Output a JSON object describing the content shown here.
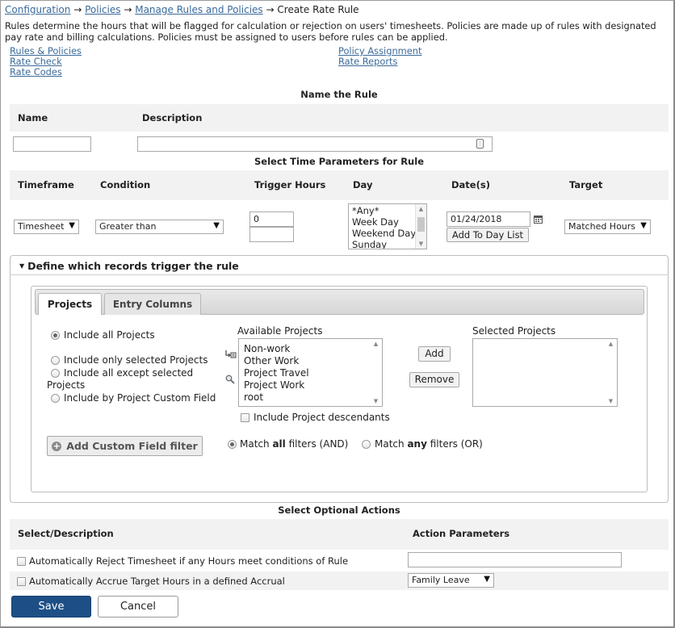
{
  "breadcrumb": {
    "items": [
      "Configuration",
      "Policies",
      "Manage Rules and Policies"
    ],
    "separator": "→",
    "current": "Create Rate Rule"
  },
  "intro": "Rules determine the hours that will be flagged for calculation or rejection on users' timesheets. Policies are made up of rules with designated pay rate and billing calculations. Policies must be assigned to users before rules can be applied.",
  "quick_links": {
    "left": [
      "Rules & Policies",
      "Rate Check",
      "Rate Codes"
    ],
    "right": [
      "Policy Assignment",
      "Rate Reports"
    ]
  },
  "name_section": {
    "title": "Name the Rule",
    "name_label": "Name",
    "description_label": "Description",
    "name_value": "",
    "description_value": ""
  },
  "time_params": {
    "title": "Select Time Parameters for Rule",
    "headers": [
      "Timeframe",
      "Condition",
      "Trigger Hours",
      "Day",
      "Date(s)",
      "Target"
    ],
    "timeframe": "Timesheet",
    "condition": "Greater than",
    "trigger_hours_1": "0",
    "trigger_hours_2": "",
    "day_options": [
      "*Any*",
      "Week Day",
      "Weekend Day",
      "Sunday"
    ],
    "date_value": "01/24/2018",
    "add_day_button": "Add To Day List",
    "target": "Matched Hours"
  },
  "define_records": {
    "title": "Define which records trigger the rule",
    "tabs": [
      "Projects",
      "Entry Columns"
    ],
    "radios": [
      "Include all Projects",
      "Include only selected Projects",
      "Include all except selected",
      "Projects",
      "Include by Project Custom Field"
    ],
    "available_label": "Available Projects",
    "available_projects": [
      "Non-work",
      "Other Work",
      "Project Travel",
      "Project Work",
      "root"
    ],
    "selected_label": "Selected Projects",
    "add_button": "Add",
    "remove_button": "Remove",
    "include_descendants": "Include Project descendants",
    "add_filter_button": "Add Custom Field filter",
    "match_all_prefix": "Match ",
    "match_all_bold": "all",
    "match_all_suffix": " filters (AND)",
    "match_any_prefix": "Match ",
    "match_any_bold": "any",
    "match_any_suffix": " filters (OR)"
  },
  "optional_actions": {
    "title": "Select Optional Actions",
    "col_left": "Select/Description",
    "col_right": "Action Parameters",
    "rows": [
      {
        "label": "Automatically Reject Timesheet if any Hours meet conditions of Rule",
        "param": ""
      },
      {
        "label": "Automatically Accrue Target Hours in a defined Accrual",
        "param": "Family Leave"
      }
    ]
  },
  "footer": {
    "save": "Save",
    "cancel": "Cancel"
  },
  "colors": {
    "link": "#3a6a9a",
    "primary_button": "#1d4f86",
    "band": "#f2f2f2"
  }
}
